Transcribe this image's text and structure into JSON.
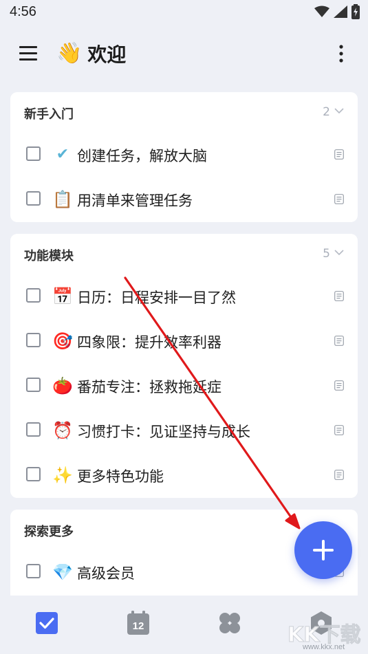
{
  "status_bar": {
    "time": "4:56"
  },
  "header": {
    "title_emoji": "👋",
    "title": "欢迎"
  },
  "sections": [
    {
      "title": "新手入门",
      "count": "2",
      "tasks": [
        {
          "emoji": "✔",
          "label": "创建任务，解放大脑"
        },
        {
          "emoji": "📋",
          "label": "用清单来管理任务"
        }
      ]
    },
    {
      "title": "功能模块",
      "count": "5",
      "tasks": [
        {
          "emoji": "📅",
          "label": "日历：日程安排一目了然"
        },
        {
          "emoji": "🎯",
          "label": "四象限：提升效率利器"
        },
        {
          "emoji": "🍅",
          "label": "番茄专注：拯救拖延症"
        },
        {
          "emoji": "⏰",
          "label": "习惯打卡：见证坚持与成长"
        },
        {
          "emoji": "✨",
          "label": "更多特色功能"
        }
      ]
    },
    {
      "title": "探索更多",
      "tasks": [
        {
          "emoji": "💎",
          "label": "高级会员"
        }
      ]
    }
  ],
  "bottom_nav": {
    "calendar_day": "12"
  },
  "watermark": {
    "text": "KK下载",
    "url": "www.kkx.net"
  },
  "colors": {
    "accent": "#4a6cf2",
    "arrow": "#e0191b",
    "background": "#eef0f6"
  }
}
